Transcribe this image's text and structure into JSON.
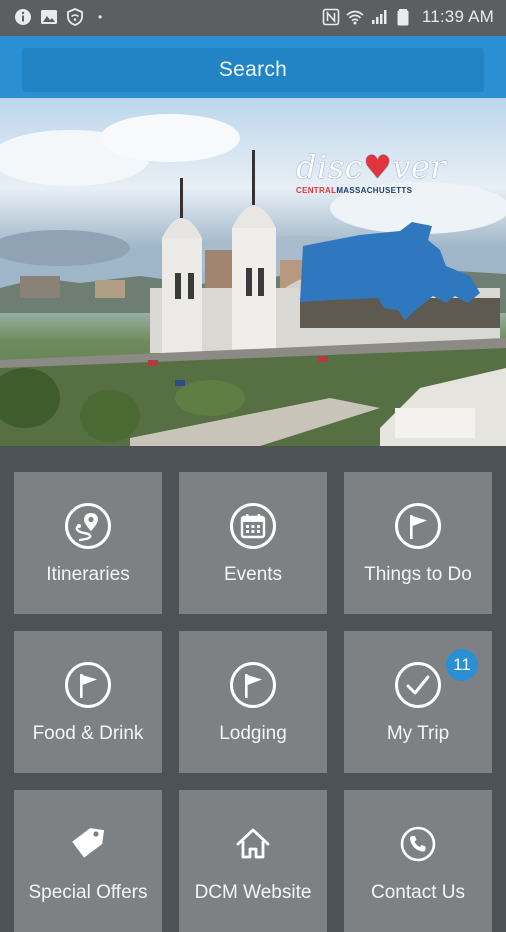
{
  "status_bar": {
    "time": "11:39 AM"
  },
  "search": {
    "label": "Search"
  },
  "hero": {
    "logo_text_1": "disc",
    "logo_text_2": "ver",
    "logo_subtext_1": "CENTRAL",
    "logo_subtext_2": "MASSACHUSETTS"
  },
  "tiles": [
    {
      "label": "Itineraries",
      "icon": "map-pin-route-icon"
    },
    {
      "label": "Events",
      "icon": "calendar-icon"
    },
    {
      "label": "Things to Do",
      "icon": "flag-icon"
    },
    {
      "label": "Food & Drink",
      "icon": "flag-icon"
    },
    {
      "label": "Lodging",
      "icon": "flag-icon"
    },
    {
      "label": "My Trip",
      "icon": "checkmark-icon",
      "badge": "11"
    },
    {
      "label": "Special Offers",
      "icon": "tag-icon"
    },
    {
      "label": "DCM Website",
      "icon": "home-icon"
    },
    {
      "label": "Contact Us",
      "icon": "phone-icon"
    }
  ],
  "colors": {
    "header_blue": "#2a8fd3",
    "tile_gray": "#7d8184",
    "background": "#4c5256",
    "logo_heart": "#e0353d"
  }
}
